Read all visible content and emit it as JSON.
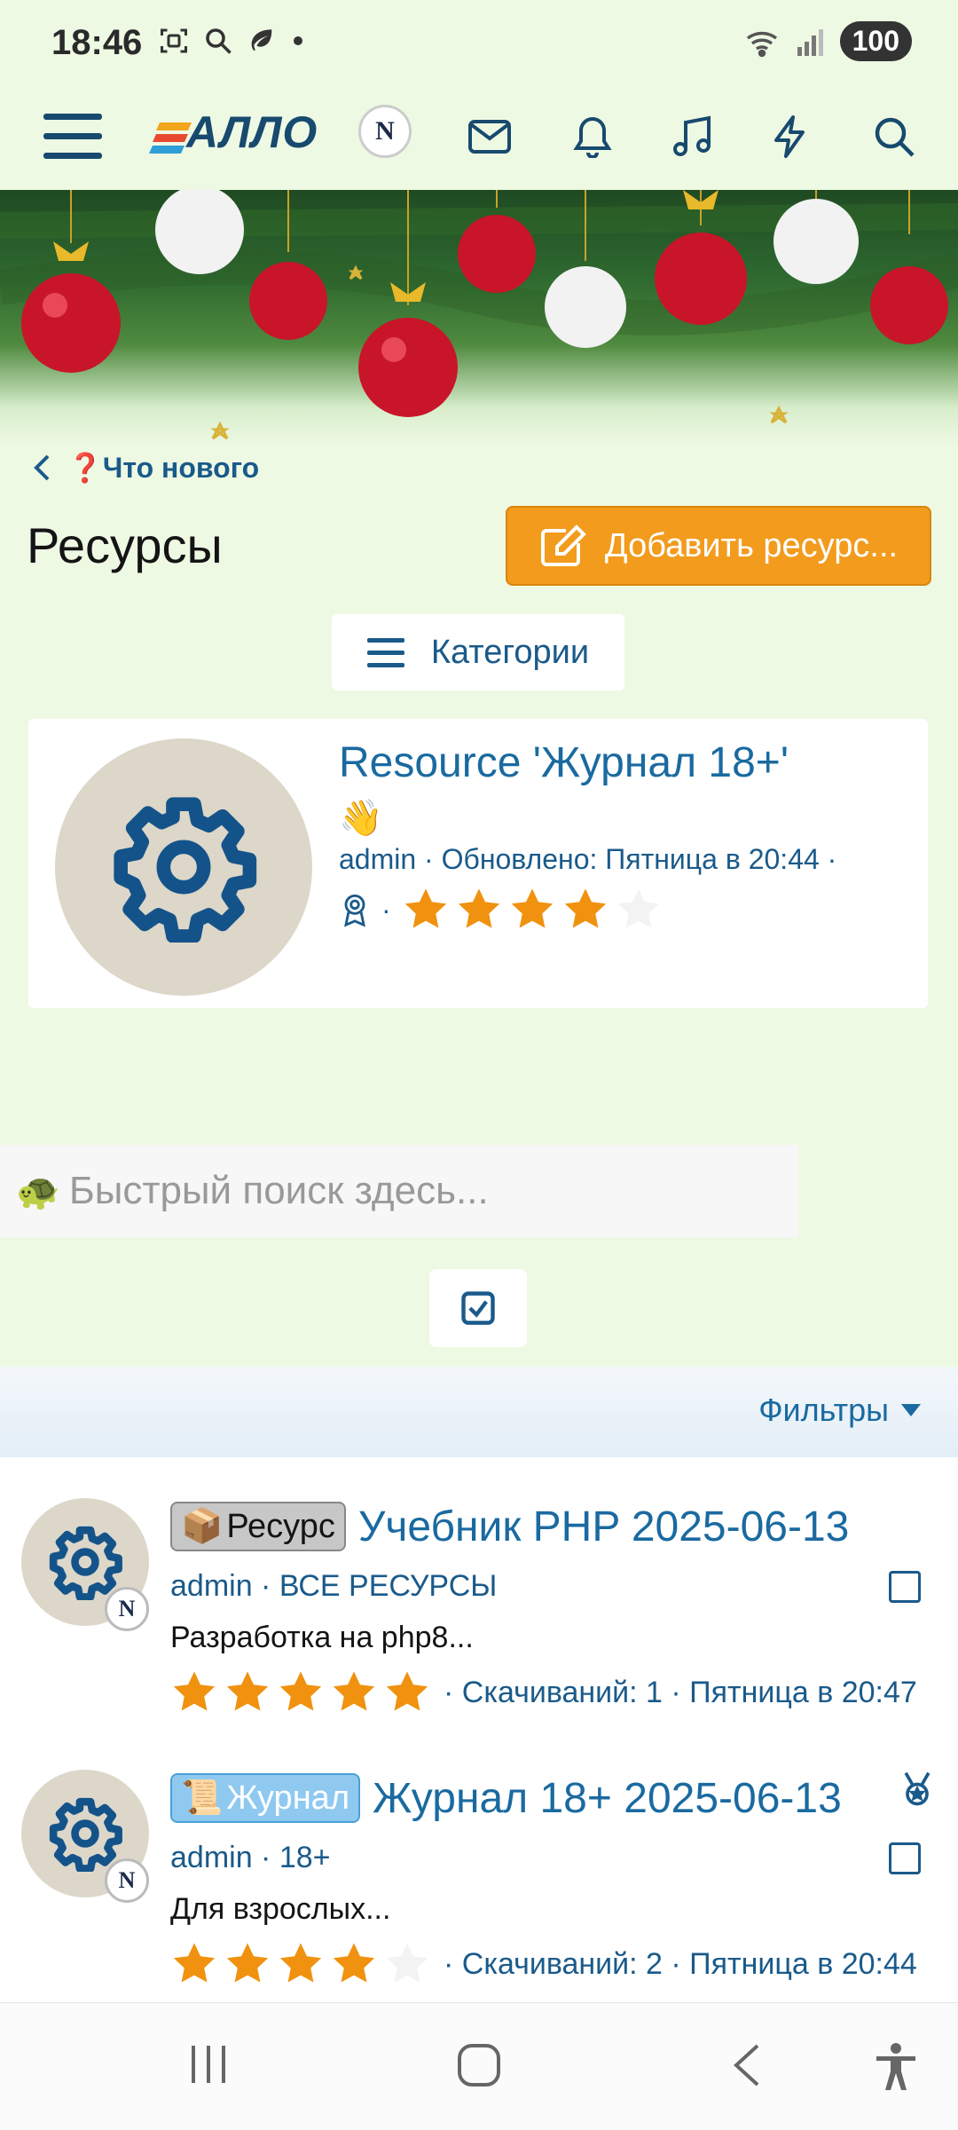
{
  "status_bar": {
    "time": "18:46",
    "battery": "100"
  },
  "header": {
    "logo_text": "АЛЛО",
    "logo_mark": "N",
    "icons": [
      "menu-icon",
      "mail-icon",
      "bell-icon",
      "music-icon",
      "lightning-icon",
      "search-icon"
    ]
  },
  "breadcrumb": {
    "label": "❓Что нового"
  },
  "page": {
    "title": "Ресурсы",
    "add_button": "Добавить ресурс...",
    "categories_button": "Категории"
  },
  "featured": {
    "title": "Resource 'Журнал 18+'",
    "emoji": "👋",
    "meta": "admin · Обновлено: Пятница в 20:44 ·",
    "rating": 4,
    "max_rating": 5
  },
  "quick_search": {
    "placeholder": "Быстрый поиск здесь...",
    "icon": "🐢"
  },
  "filters": {
    "label": "Фильтры"
  },
  "items": [
    {
      "prefix_icon": "📦",
      "prefix": "Ресурс",
      "title": "Учебник PHP 2025-06-13",
      "meta": "admin · ВСЕ РЕСУРСЫ",
      "description": "Разработка на php8...",
      "rating": 5,
      "footer": "· Скачиваний: 1 · Пятница в 20:47"
    },
    {
      "prefix_icon": "📜",
      "prefix": "Журнал",
      "title": "Журнал 18+ 2025-06-13",
      "meta": "admin · 18+",
      "description": "Для взрослых...",
      "rating": 4,
      "footer": "· Скачиваний: 2 · Пятница в 20:44"
    }
  ],
  "colors": {
    "accent": "#1a6aa0",
    "button_orange": "#f29b1d",
    "star": "#f0920f",
    "background": "#eef9e4"
  }
}
